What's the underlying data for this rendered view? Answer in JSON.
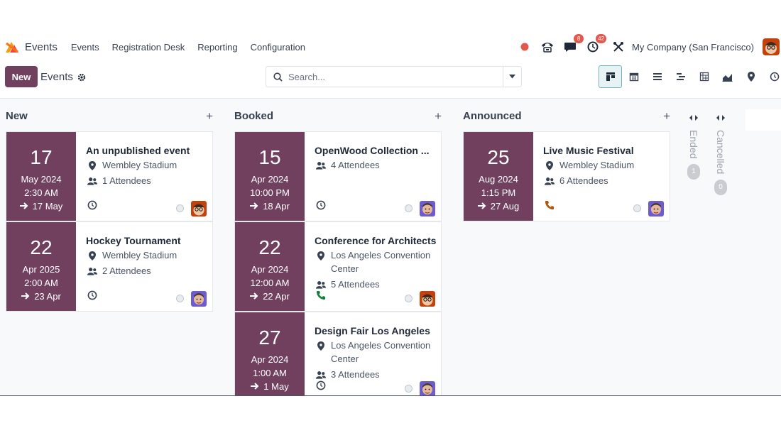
{
  "app": {
    "name": "Events"
  },
  "menu": [
    "Events",
    "Registration Desk",
    "Reporting",
    "Configuration"
  ],
  "systray": {
    "messages_count": "8",
    "activities_count": "42",
    "company": "My Company (San Francisco)"
  },
  "control": {
    "new_label": "New",
    "breadcrumb": "Events",
    "search_placeholder": "Search..."
  },
  "views": [
    "kanban-view-icon",
    "calendar-view-icon",
    "list-view-icon",
    "gantt-view-icon",
    "pivot-view-icon",
    "graph-view-icon",
    "map-view-icon",
    "activity-view-icon"
  ],
  "columns": [
    {
      "title": "New",
      "cards": [
        {
          "day": "17",
          "month": "May 2024",
          "time": "2:30 AM",
          "end": "17 May",
          "title": "An unpublished event",
          "location": [
            "Wembley Stadium"
          ],
          "attendees": "1 Attendees",
          "activity": "clock",
          "avatar": "a"
        },
        {
          "day": "22",
          "month": "Apr 2025",
          "time": "2:00 AM",
          "end": "23 Apr",
          "title": "Hockey Tournament",
          "location": [
            "Wembley Stadium"
          ],
          "attendees": "2 Attendees",
          "activity": "clock",
          "avatar": "b"
        }
      ]
    },
    {
      "title": "Booked",
      "cards": [
        {
          "day": "15",
          "month": "Apr 2024",
          "time": "10:00 PM",
          "end": "18 Apr",
          "title": "OpenWood Collection ...",
          "location": [],
          "attendees": "4 Attendees",
          "activity": "clock",
          "avatar": "b"
        },
        {
          "day": "22",
          "month": "Apr 2024",
          "time": "12:00 AM",
          "end": "22 Apr",
          "title": "Conference for Architects",
          "location": [
            "Los Angeles Convention",
            "Center"
          ],
          "attendees": "5 Attendees",
          "activity": "phone-green",
          "avatar": "a"
        },
        {
          "day": "27",
          "month": "Apr 2024",
          "time": "1:00 AM",
          "end": "1 May",
          "title": "Design Fair Los Angeles",
          "location": [
            "Los Angeles Convention",
            "Center"
          ],
          "attendees": "3 Attendees",
          "activity": "clock",
          "avatar": "b"
        }
      ]
    },
    {
      "title": "Announced",
      "cards": [
        {
          "day": "25",
          "month": "Aug 2024",
          "time": "1:15 PM",
          "end": "27 Aug",
          "title": "Live Music Festival",
          "location": [
            "Wembley Stadium"
          ],
          "attendees": "6 Attendees",
          "activity": "phone-orange",
          "avatar": "b"
        }
      ]
    }
  ],
  "folded": [
    {
      "title": "Ended",
      "count": "1"
    },
    {
      "title": "Cancelled",
      "count": "0"
    }
  ],
  "colors": {
    "brand": "#71405f",
    "badge": "#e4574c",
    "active_view": "#6fb7bd"
  }
}
